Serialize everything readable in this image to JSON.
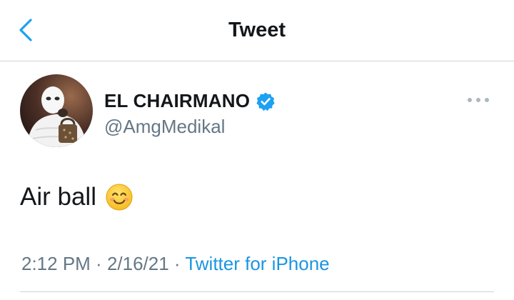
{
  "header": {
    "title": "Tweet",
    "back_icon": "chevron-left-icon",
    "accent_color": "#1da1f2"
  },
  "tweet": {
    "author": {
      "display_name": "EL CHAIRMANO",
      "handle": "@AmgMedikal",
      "verified": true,
      "verified_icon": "verified-badge-icon"
    },
    "more_icon": "more-options-icon",
    "text": "Air ball",
    "emoji": "smiling-face-emoji",
    "time": "2:12 PM",
    "separator": " · ",
    "date": "2/16/21",
    "source": "Twitter for iPhone"
  },
  "colors": {
    "text_primary": "#14171a",
    "text_secondary": "#657786",
    "link": "#1b95e0",
    "divider": "#cfd3d6"
  }
}
